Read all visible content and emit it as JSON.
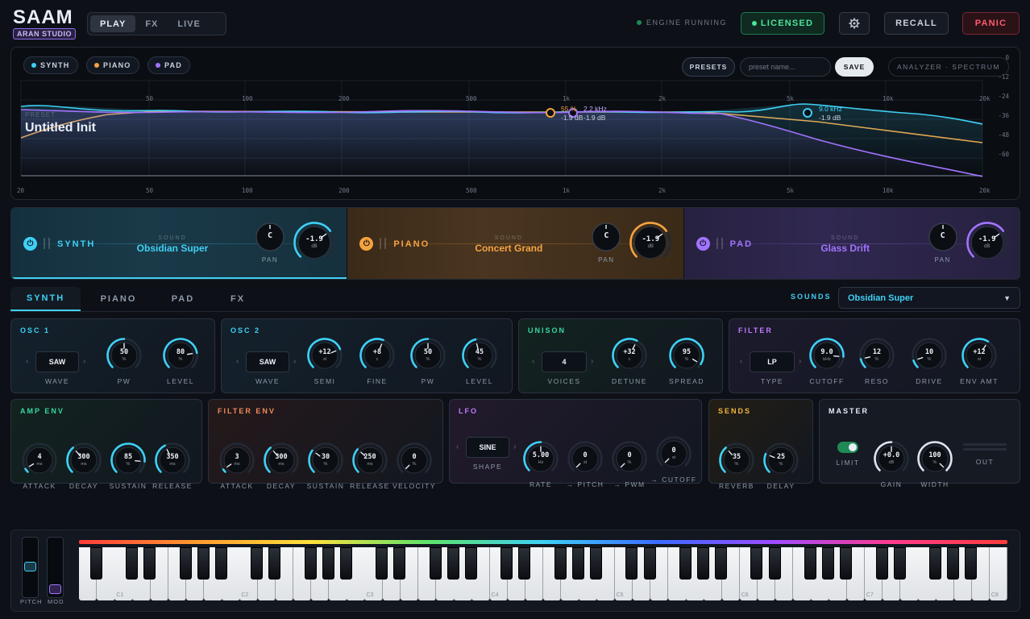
{
  "header": {
    "logo": "SAAM",
    "studio": "ARAN STUDIO",
    "mode_tabs": [
      {
        "label": "PLAY",
        "active": true
      },
      {
        "label": "FX",
        "active": false
      },
      {
        "label": "LIVE",
        "active": false
      }
    ],
    "engine_status": "ENGINE RUNNING",
    "licensed_label": "LICENSED",
    "settings_icon": "gear-icon",
    "recall_label": "RECALL",
    "panic_label": "PANIC"
  },
  "analyzer": {
    "layers": [
      {
        "label": "SYNTH",
        "color": "#3fd0f5"
      },
      {
        "label": "PIANO",
        "color": "#f5a33f"
      },
      {
        "label": "PAD",
        "color": "#a274ff"
      }
    ],
    "presets_label": "PRESETS",
    "preset_placeholder": "preset name...",
    "save_label": "SAVE",
    "mode_label": "ANALYZER · SPECTRUM",
    "preset_tiny": "PRESET",
    "preset_name": "Untitled Init",
    "freq_ticks": [
      "20",
      "50",
      "100",
      "200",
      "500",
      "1k",
      "2k",
      "5k",
      "10k",
      "20k"
    ],
    "db_ticks": [
      "0",
      "-12",
      "-24",
      "-36",
      "-48",
      "-60"
    ],
    "readouts": [
      {
        "line1": "55 %",
        "line2": "-1.9 dB"
      },
      {
        "line1": "2.2 kHz",
        "line2": "-1.9 dB"
      },
      {
        "line1": "9.0 kHz",
        "line2": "-1.9 dB"
      }
    ]
  },
  "strips": [
    {
      "name": "SYNTH",
      "sound_label": "SOUND",
      "sound": "Obsidian Super",
      "pan": "C",
      "pan_label": "PAN",
      "level": "-1.9",
      "unit": "dB",
      "color": "#3fd0f5"
    },
    {
      "name": "PIANO",
      "sound_label": "SOUND",
      "sound": "Concert Grand",
      "pan": "C",
      "pan_label": "PAN",
      "level": "-1.9",
      "unit": "dB",
      "color": "#f5a33f"
    },
    {
      "name": "PAD",
      "sound_label": "SOUND",
      "sound": "Glass Drift",
      "pan": "C",
      "pan_label": "PAN",
      "level": "-1.9",
      "unit": "dB",
      "color": "#a274ff"
    }
  ],
  "section_tabs": [
    {
      "label": "SYNTH",
      "active": true
    },
    {
      "label": "PIANO",
      "active": false
    },
    {
      "label": "PAD",
      "active": false
    },
    {
      "label": "FX",
      "active": false
    }
  ],
  "sounds": {
    "label": "SOUNDS",
    "value": "Obsidian Super"
  },
  "panels": {
    "osc1": {
      "title": "OSC 1",
      "wave": "SAW",
      "wave_label": "WAVE",
      "knobs": [
        {
          "v": "50",
          "u": "%",
          "l": "PW",
          "f": 0.5
        },
        {
          "v": "80",
          "u": "%",
          "l": "LEVEL",
          "f": 0.8
        }
      ]
    },
    "osc2": {
      "title": "OSC 2",
      "wave": "SAW",
      "wave_label": "WAVE",
      "knobs": [
        {
          "v": "+12",
          "u": "st",
          "l": "SEMI",
          "f": 0.75
        },
        {
          "v": "+8",
          "u": "c",
          "l": "FINE",
          "f": 0.58
        },
        {
          "v": "50",
          "u": "%",
          "l": "PW",
          "f": 0.5
        },
        {
          "v": "45",
          "u": "%",
          "l": "LEVEL",
          "f": 0.45
        }
      ]
    },
    "unison": {
      "title": "UNISON",
      "voices": "4",
      "voices_label": "VOICES",
      "knobs": [
        {
          "v": "+32",
          "u": "c",
          "l": "DETUNE",
          "f": 0.6
        },
        {
          "v": "95",
          "u": "%",
          "l": "SPREAD",
          "f": 0.95
        }
      ]
    },
    "filter": {
      "title": "FILTER",
      "type": "LP",
      "type_label": "TYPE",
      "knobs": [
        {
          "v": "9.0",
          "u": "kHz",
          "l": "CUTOFF",
          "f": 0.85
        },
        {
          "v": "12",
          "u": "%",
          "l": "RESO",
          "f": 0.12
        },
        {
          "v": "10",
          "u": "%",
          "l": "DRIVE",
          "f": 0.1
        },
        {
          "v": "+12",
          "u": "st",
          "l": "ENV AMT",
          "f": 0.62
        }
      ]
    },
    "ampenv": {
      "title": "AMP ENV",
      "knobs": [
        {
          "v": "4",
          "u": "ms",
          "l": "ATTACK",
          "f": 0.05
        },
        {
          "v": "300",
          "u": "ms",
          "l": "DECAY",
          "f": 0.35
        },
        {
          "v": "85",
          "u": "%",
          "l": "SUSTAIN",
          "f": 0.85
        },
        {
          "v": "350",
          "u": "ms",
          "l": "RELEASE",
          "f": 0.4
        }
      ]
    },
    "filterenv": {
      "title": "FILTER ENV",
      "knobs": [
        {
          "v": "3",
          "u": "ms",
          "l": "ATTACK",
          "f": 0.04
        },
        {
          "v": "300",
          "u": "ms",
          "l": "DECAY",
          "f": 0.35
        },
        {
          "v": "30",
          "u": "%",
          "l": "SUSTAIN",
          "f": 0.3
        },
        {
          "v": "250",
          "u": "ms",
          "l": "RELEASE",
          "f": 0.32
        },
        {
          "v": "0",
          "u": "%",
          "l": "VELOCITY",
          "f": 0.0
        }
      ]
    },
    "lfo": {
      "title": "LFO",
      "shape": "SINE",
      "shape_label": "SHAPE",
      "knobs": [
        {
          "v": "5.00",
          "u": "Hz",
          "l": "RATE",
          "f": 0.5
        },
        {
          "v": "0",
          "u": "st",
          "l": "→ PITCH",
          "f": 0.0
        },
        {
          "v": "0",
          "u": "%",
          "l": "→ PWM",
          "f": 0.0
        },
        {
          "v": "0",
          "u": "st",
          "l": "→ CUTOFF",
          "f": 0.0
        }
      ]
    },
    "sends": {
      "title": "SENDS",
      "knobs": [
        {
          "v": "35",
          "u": "%",
          "l": "REVERB",
          "f": 0.35
        },
        {
          "v": "25",
          "u": "%",
          "l": "DELAY",
          "f": 0.25
        }
      ]
    },
    "master": {
      "title": "MASTER",
      "limit_label": "LIMIT",
      "out_label": "OUT",
      "knobs": [
        {
          "v": "+0.0",
          "u": "dB",
          "l": "GAIN",
          "f": 0.5
        },
        {
          "v": "100",
          "u": "%",
          "l": "WIDTH",
          "f": 1.0
        }
      ]
    }
  },
  "keyboard": {
    "pitch_label": "PITCH",
    "mod_label": "MOD",
    "octave_labels": [
      "C1",
      "C2",
      "C3",
      "C4",
      "C5",
      "C6",
      "C7",
      "C8"
    ]
  }
}
